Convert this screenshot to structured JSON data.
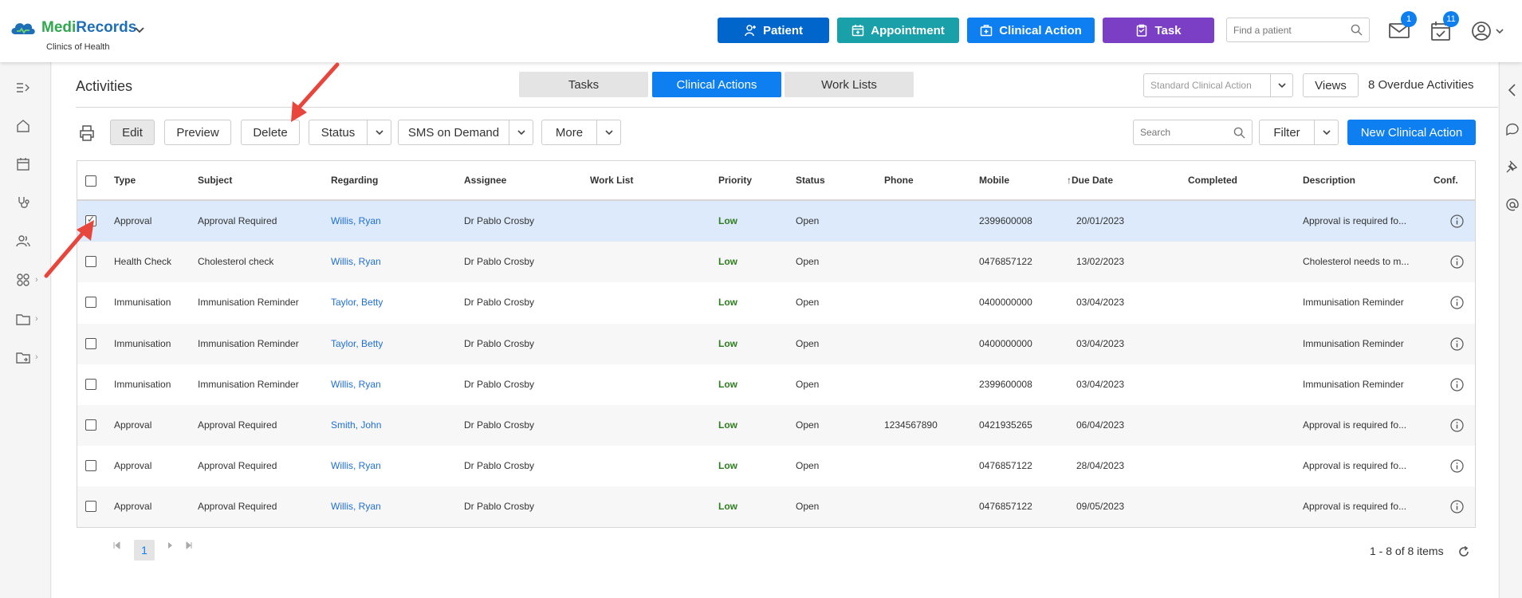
{
  "header": {
    "brand_part1": "Medi",
    "brand_part2": "Records",
    "clinic": "Clinics of Health",
    "buttons": {
      "patient": "Patient",
      "appointment": "Appointment",
      "clinical_action": "Clinical Action",
      "task": "Task"
    },
    "find_patient_placeholder": "Find a patient",
    "mail_badge": "1",
    "tasks_badge": "11"
  },
  "page": {
    "title": "Activities",
    "tabs": [
      "Tasks",
      "Clinical Actions",
      "Work Lists"
    ],
    "active_tab": "Clinical Actions",
    "standard_select": "Standard Clinical Action",
    "views_label": "Views",
    "overdue": "8 Overdue Activities"
  },
  "toolbar": {
    "edit": "Edit",
    "preview": "Preview",
    "delete": "Delete",
    "status": "Status",
    "sms": "SMS on Demand",
    "more": "More",
    "search_placeholder": "Search",
    "filter": "Filter",
    "new_action": "New Clinical Action"
  },
  "table": {
    "columns": [
      "Type",
      "Subject",
      "Regarding",
      "Assignee",
      "Work List",
      "Priority",
      "Status",
      "Phone",
      "Mobile",
      "Due Date",
      "Completed",
      "Description",
      "Conf."
    ],
    "rows": [
      {
        "type": "Approval",
        "subject": "Approval Required",
        "regarding": "Willis, Ryan",
        "assignee": "Dr Pablo Crosby",
        "worklist": "",
        "priority": "Low",
        "status": "Open",
        "phone": "",
        "mobile": "2399600008",
        "due": "20/01/2023",
        "completed": "",
        "description": "Approval is required fo...",
        "checked": true
      },
      {
        "type": "Health Check",
        "subject": "Cholesterol check",
        "regarding": "Willis, Ryan",
        "assignee": "Dr Pablo Crosby",
        "worklist": "",
        "priority": "Low",
        "status": "Open",
        "phone": "",
        "mobile": "0476857122",
        "due": "13/02/2023",
        "completed": "",
        "description": "Cholesterol needs to m...",
        "checked": false
      },
      {
        "type": "Immunisation",
        "subject": "Immunisation Reminder",
        "regarding": "Taylor, Betty",
        "assignee": "Dr Pablo Crosby",
        "worklist": "",
        "priority": "Low",
        "status": "Open",
        "phone": "",
        "mobile": "0400000000",
        "due": "03/04/2023",
        "completed": "",
        "description": "Immunisation Reminder",
        "checked": false
      },
      {
        "type": "Immunisation",
        "subject": "Immunisation Reminder",
        "regarding": "Taylor, Betty",
        "assignee": "Dr Pablo Crosby",
        "worklist": "",
        "priority": "Low",
        "status": "Open",
        "phone": "",
        "mobile": "0400000000",
        "due": "03/04/2023",
        "completed": "",
        "description": "Immunisation Reminder",
        "checked": false
      },
      {
        "type": "Immunisation",
        "subject": "Immunisation Reminder",
        "regarding": "Willis, Ryan",
        "assignee": "Dr Pablo Crosby",
        "worklist": "",
        "priority": "Low",
        "status": "Open",
        "phone": "",
        "mobile": "2399600008",
        "due": "03/04/2023",
        "completed": "",
        "description": "Immunisation Reminder",
        "checked": false
      },
      {
        "type": "Approval",
        "subject": "Approval Required",
        "regarding": "Smith, John",
        "assignee": "Dr Pablo Crosby",
        "worklist": "",
        "priority": "Low",
        "status": "Open",
        "phone": "1234567890",
        "mobile": "0421935265",
        "due": "06/04/2023",
        "completed": "",
        "description": "Approval is required fo...",
        "checked": false
      },
      {
        "type": "Approval",
        "subject": "Approval Required",
        "regarding": "Willis, Ryan",
        "assignee": "Dr Pablo Crosby",
        "worklist": "",
        "priority": "Low",
        "status": "Open",
        "phone": "",
        "mobile": "0476857122",
        "due": "28/04/2023",
        "completed": "",
        "description": "Approval is required fo...",
        "checked": false
      },
      {
        "type": "Approval",
        "subject": "Approval Required",
        "regarding": "Willis, Ryan",
        "assignee": "Dr Pablo Crosby",
        "worklist": "",
        "priority": "Low",
        "status": "Open",
        "phone": "",
        "mobile": "0476857122",
        "due": "09/05/2023",
        "completed": "",
        "description": "Approval is required fo...",
        "checked": false
      }
    ]
  },
  "pager": {
    "current_page": "1",
    "summary": "1 - 8 of 8 items"
  },
  "colors": {
    "primary": "#0d7ff0",
    "teal": "#1aa0a8",
    "purple": "#7b3fc6",
    "selected_row": "#dceafb",
    "priority_low": "#2e7d1f",
    "annotation_arrow": "#e8453c"
  }
}
